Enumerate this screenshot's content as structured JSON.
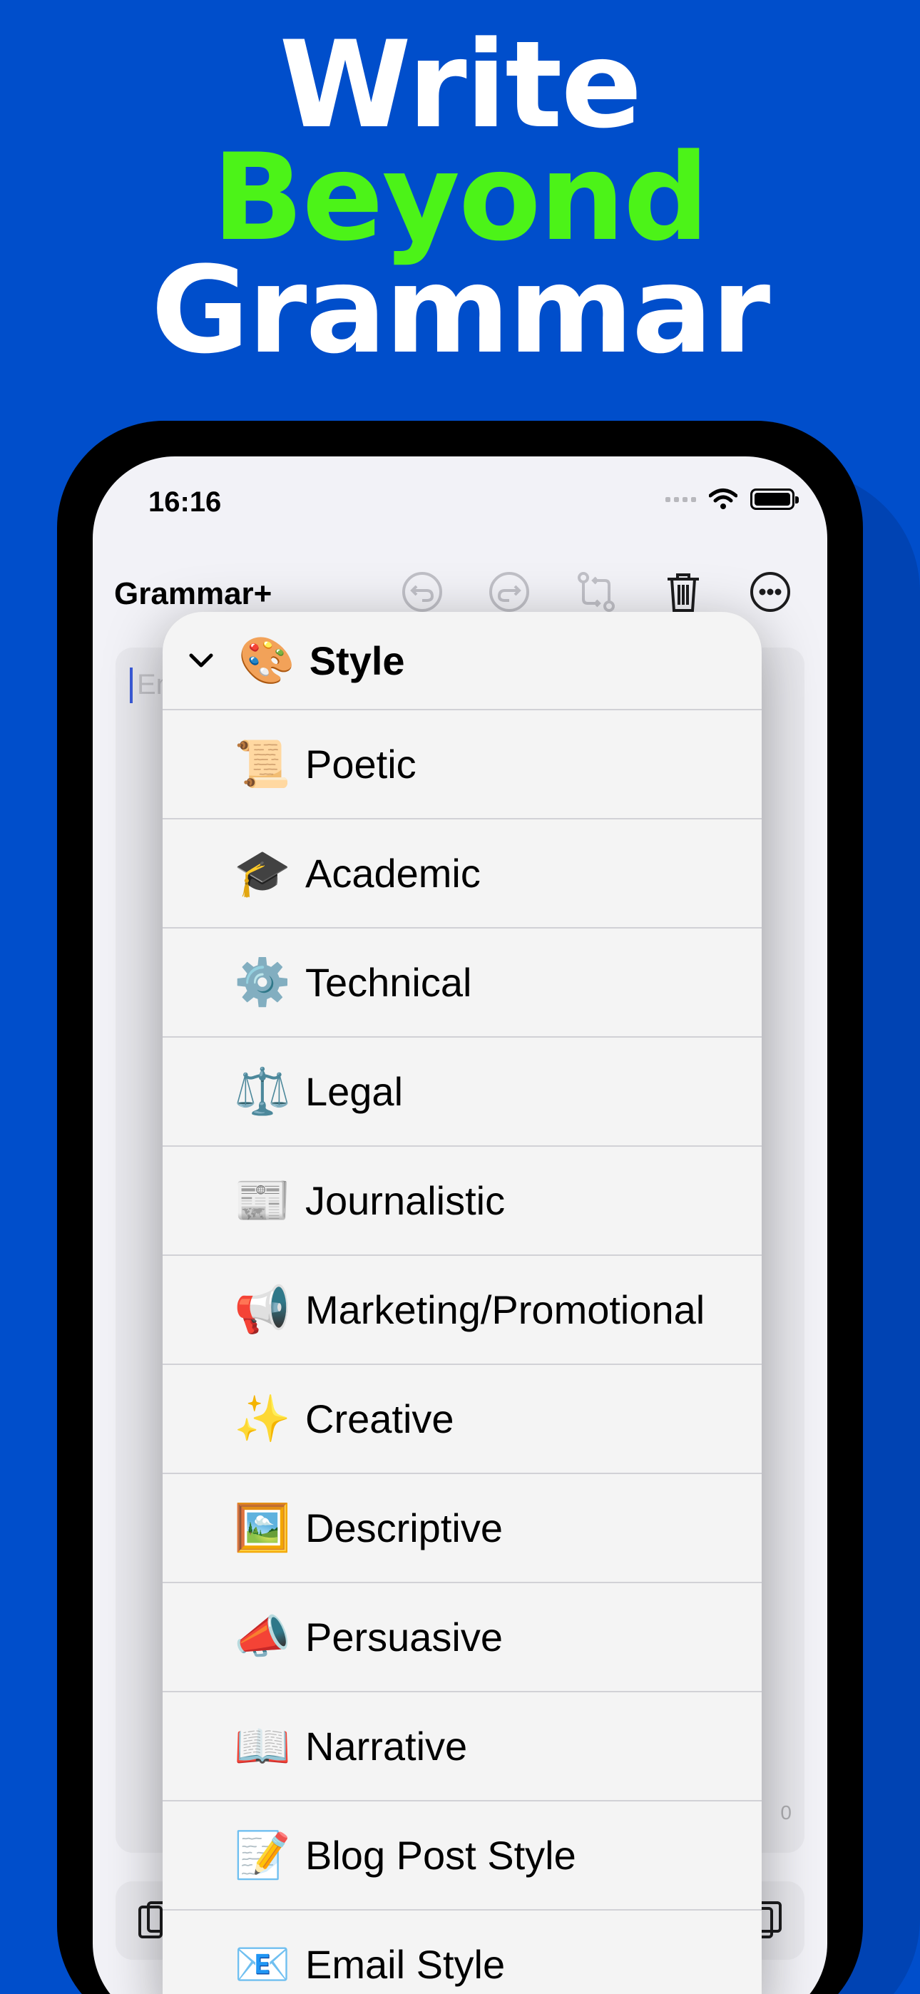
{
  "headline": {
    "line1": "Write",
    "line2": "Beyond",
    "line3": "Grammar"
  },
  "status_bar": {
    "time": "16:16"
  },
  "app": {
    "title": "Grammar+",
    "placeholder": "En",
    "char_count": "0"
  },
  "toolbar": {
    "icons": [
      "undo-icon",
      "redo-icon",
      "swap-icon",
      "trash-icon",
      "more-icon"
    ]
  },
  "menu": {
    "header": {
      "emoji": "🎨",
      "label": "Style"
    },
    "items": [
      {
        "emoji": "📜",
        "label": "Poetic"
      },
      {
        "emoji": "🎓",
        "label": "Academic"
      },
      {
        "emoji": "⚙️",
        "label": "Technical"
      },
      {
        "emoji": "⚖️",
        "label": "Legal"
      },
      {
        "emoji": "📰",
        "label": "Journalistic"
      },
      {
        "emoji": "📢",
        "label": "Marketing/Promotional"
      },
      {
        "emoji": "✨",
        "label": "Creative"
      },
      {
        "emoji": "🖼️",
        "label": "Descriptive"
      },
      {
        "emoji": "📣",
        "label": "Persuasive"
      },
      {
        "emoji": "📖",
        "label": "Narrative"
      },
      {
        "emoji": "📝",
        "label": "Blog Post Style"
      },
      {
        "emoji": "📧",
        "label": "Email Style"
      }
    ]
  },
  "colors": {
    "background": "#004ecb",
    "accent": "#4cf318"
  }
}
